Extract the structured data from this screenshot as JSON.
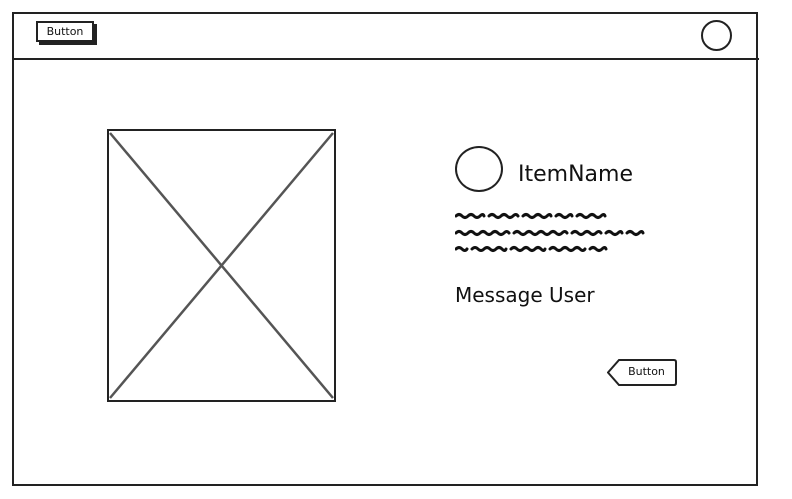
{
  "header": {
    "button_label": "Button",
    "avatar_icon": "avatar-icon"
  },
  "main": {
    "image_icon": "image-placeholder-icon",
    "item_avatar_icon": "avatar-icon",
    "item_name": "ItemName",
    "message_user_label": "Message User",
    "back_button_label": "Button"
  }
}
